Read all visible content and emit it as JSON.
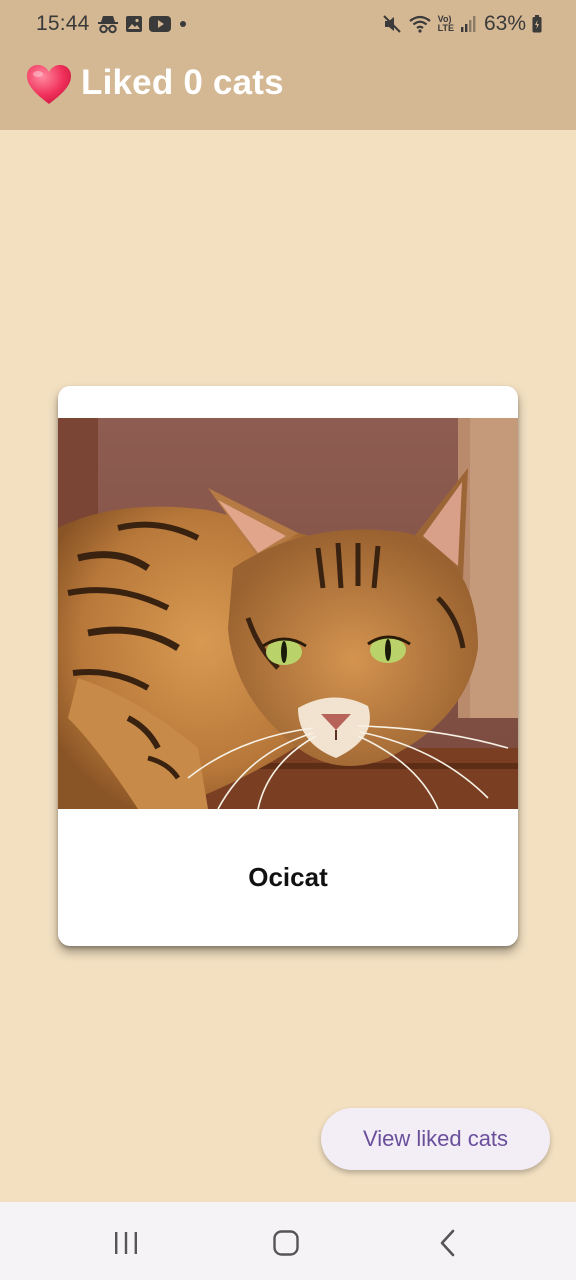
{
  "status_bar": {
    "time": "15:44",
    "notification_icons": [
      "incognito-icon",
      "gallery-icon",
      "youtube-icon",
      "dot-icon"
    ],
    "system_icons": [
      "mute-icon",
      "wifi-icon",
      "volte-icon",
      "signal-icon",
      "battery-icon"
    ],
    "volte_label": "Vo)",
    "lte_label": "LTE",
    "battery_percent": "63%"
  },
  "app_bar": {
    "heart_icon": "heart-icon",
    "title": "Liked 0 cats",
    "color": "#d4b793"
  },
  "card": {
    "image": "cat-photo",
    "cat_name": "Ocicat"
  },
  "fab": {
    "label": "View liked cats",
    "text_color": "#6a4f9b"
  },
  "nav_bar": {
    "buttons": [
      "recents-icon",
      "home-icon",
      "back-icon"
    ]
  },
  "colors": {
    "background": "#f3e0c1",
    "header": "#d4b793",
    "card": "#ffffff"
  }
}
